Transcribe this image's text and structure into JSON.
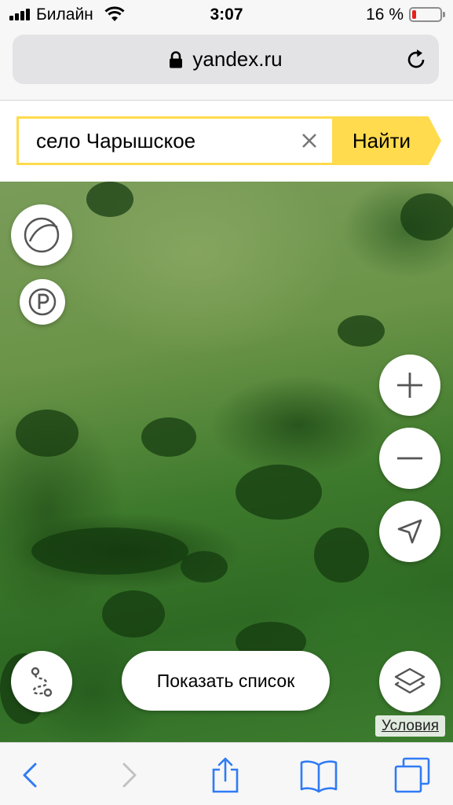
{
  "status_bar": {
    "carrier": "Билайн",
    "time": "3:07",
    "battery_percent": "16 %",
    "battery_level": 0.16
  },
  "browser": {
    "url": "yandex.ru"
  },
  "search": {
    "query": "село Чарышское",
    "find_label": "Найти",
    "accent_color": "#ffdb4d"
  },
  "map": {
    "show_list_label": "Показать список",
    "terms_label": "Условия"
  },
  "icons": [
    "signal-icon",
    "wifi-icon",
    "battery-icon",
    "lock-icon",
    "reload-icon",
    "clear-icon",
    "traffic-icon",
    "parking-icon",
    "zoom-in-icon",
    "zoom-out-icon",
    "location-arrow-icon",
    "route-icon",
    "layers-icon",
    "back-icon",
    "forward-icon",
    "share-icon",
    "bookmarks-icon",
    "tabs-icon"
  ]
}
